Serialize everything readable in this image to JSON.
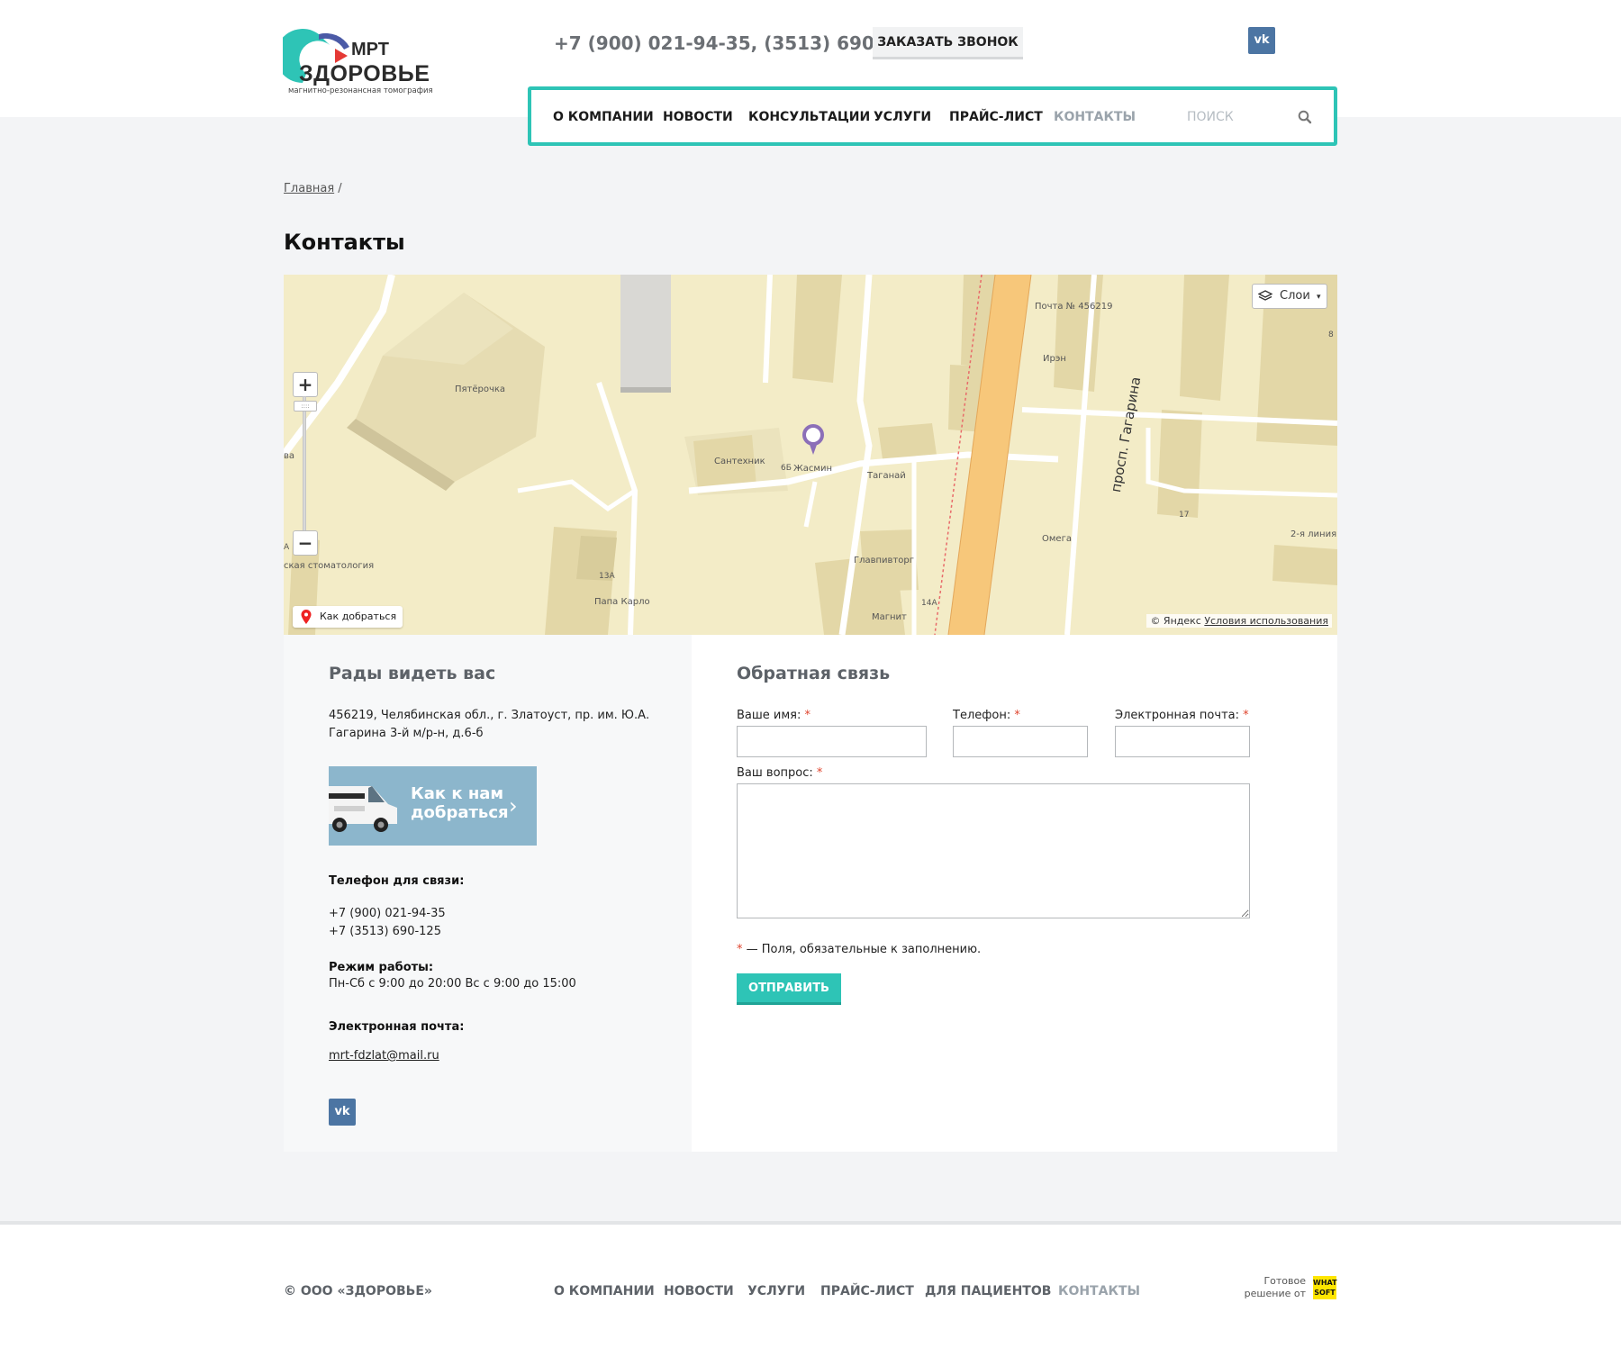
{
  "header": {
    "logo_mrt": "МРТ",
    "logo_name": "ЗДОРОВЬЕ",
    "logo_sub": "магнитно-резонансная томография",
    "phones": "+7 (900) 021-94-35, (3513) 690-125",
    "callback_label": "ЗАКАЗАТЬ ЗВОНОК",
    "vk_label": "vk"
  },
  "nav": {
    "items": [
      "О КОМПАНИИ",
      "НОВОСТИ",
      "КОНСУЛЬТАЦИИ",
      "УСЛУГИ",
      "ПРАЙС-ЛИСТ",
      "КОНТАКТЫ"
    ],
    "active_index": 5,
    "search_placeholder": "ПОИСК"
  },
  "breadcrumb": {
    "home": "Главная",
    "separator": "/"
  },
  "page_title": "Контакты",
  "map": {
    "layers_label": "Слои",
    "route_label": "Как добраться",
    "copyright": "© Яндекс",
    "terms": "Условия использования",
    "street": "просп. Гагарина",
    "places": [
      "Почта № 456219",
      "Ирэн",
      "Пятёрочка",
      "Сантехник",
      "Жасмин",
      "Таганай",
      "Омега",
      "Главпивторг",
      "Папа Карло",
      "Магнит",
      "ская стоматология",
      "ва",
      "2-я линия"
    ],
    "house_numbers": [
      "6Б",
      "17",
      "13А",
      "14А",
      "8",
      "А"
    ]
  },
  "left": {
    "title": "Рады видеть вас",
    "address": "456219, Челябинская обл., г. Златоуст, пр. им. Ю.А. Гагарина 3-й м/р-н, д.6-б",
    "banner_line1": "Как к нам",
    "banner_line2": "добраться",
    "phone_label": "Телефон для связи:",
    "phone1": "+7 (900) 021-94-35",
    "phone2": "+7 (3513) 690-125",
    "hours_label": "Режим работы:",
    "hours": "Пн-Сб с 9:00 до 20:00 Вс с 9:00 до 15:00",
    "email_label": "Электронная почта:",
    "email": "mrt-fdzlat@mail.ru"
  },
  "form": {
    "title": "Обратная связь",
    "name_label": "Ваше имя:",
    "phone_label": "Телефон:",
    "email_label": "Электронная почта:",
    "question_label": "Ваш вопрос:",
    "required_mark": "*",
    "required_note": "— Поля, обязательные к заполнению.",
    "name_value": "",
    "phone_value": "",
    "email_value": "",
    "question_value": "",
    "submit_label": "ОТПРАВИТЬ"
  },
  "footer": {
    "copyright": "© ООО «ЗДОРОВЬЕ»",
    "items": [
      "О КОМПАНИИ",
      "НОВОСТИ",
      "УСЛУГИ",
      "ПРАЙС-ЛИСТ",
      "ДЛЯ ПАЦИЕНТОВ",
      "КОНТАКТЫ"
    ],
    "ready_line1": "Готовое",
    "ready_line2": "решение от",
    "ws_line1": "WHAT",
    "ws_line2": "SOFT"
  },
  "colors": {
    "accent": "#2ec4b6",
    "vk": "#4c75a3",
    "text_muted": "#5d6268"
  }
}
